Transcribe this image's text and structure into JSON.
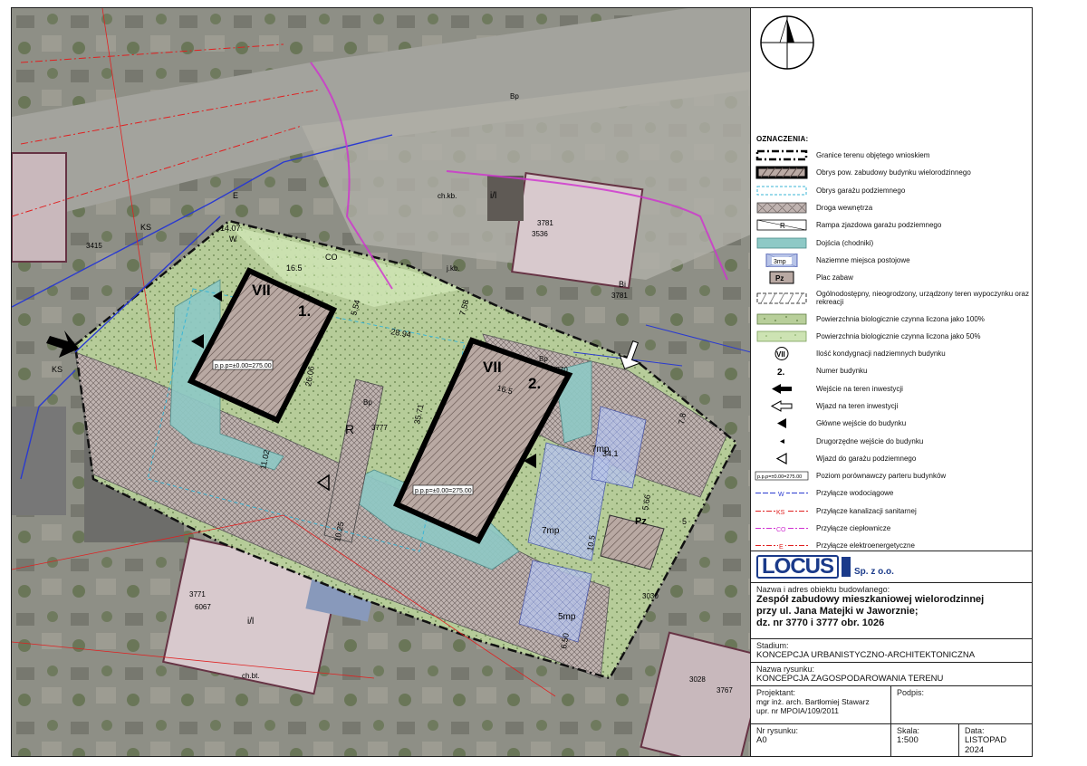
{
  "map": {
    "building_1": {
      "floors": "VII",
      "number": "1.",
      "level": "p.p.p=±0.00=275.00"
    },
    "building_2": {
      "floors": "VII",
      "number": "2.",
      "level": "p.p.p=±0.00=275.00"
    },
    "dimensions": {
      "d1": "16.5",
      "d2": "5.54",
      "d3": "7.58",
      "d4": "28.94",
      "d5": "26.06",
      "d6": "35.71",
      "d7": "16.5",
      "d8": "11.02",
      "d9": "14.07",
      "d10": "10.25",
      "d11": "34.1",
      "d12": "7.8",
      "d13": "5.66",
      "d14": "10.5",
      "d15": "6.50",
      "d16": "5"
    },
    "parking": {
      "p1": "7mp",
      "p2": "7mp",
      "p3": "5mp"
    },
    "labels": {
      "ramp": "R",
      "playground": "Pz",
      "co": "CO",
      "ks1": "KS",
      "ks2": "KS",
      "e": "E",
      "w": "W",
      "bp1": "Bp",
      "bp2": "Bp",
      "bp3": "Bp",
      "bi": "Bi",
      "n3777": "3777",
      "n3770": "3770",
      "n3781a": "3781",
      "n3781b": "3781",
      "n3536": "3536",
      "n3415": "3415",
      "n3771": "3771",
      "n6067": "6067",
      "n3767": "3767",
      "n3028": "3028",
      "n3030": "3030",
      "chkb": "ch.kb.",
      "chbt": "ch.bt.",
      "il1": "i/l",
      "il2": "i/l",
      "jkb": "j.kb."
    },
    "colors": {
      "boundary": "#111111",
      "roads": "#d8d0cc",
      "red_lines": "#e02020",
      "blue_lines": "#2a3ad0",
      "magenta_lines": "#d030d0",
      "teal": "#7ec8c8"
    }
  },
  "legend": {
    "title": "OZNACZENIA:",
    "items": [
      {
        "label": "Granice terenu objętego wnioskiem",
        "sym": "boundary"
      },
      {
        "label": "Obrys pow. zabudowy budynku wielorodzinnego",
        "sym": "building"
      },
      {
        "label": "Obrys garażu podziemnego",
        "sym": "garage"
      },
      {
        "label": "Droga wewnętrza",
        "sym": "road"
      },
      {
        "label": "Rampa zjazdowa garażu podziemnego",
        "sym": "ramp",
        "sym_text": "R"
      },
      {
        "label": "Dojścia (chodniki)",
        "sym": "walk"
      },
      {
        "label": "Naziemne miejsca postojowe",
        "sym": "parking",
        "sym_text": "3mp"
      },
      {
        "label": "Plac zabaw",
        "sym": "play",
        "sym_text": "Pz"
      },
      {
        "label": "Ogólnodostępny, nieogrodzony, urządzony teren wypoczynku oraz rekreacji",
        "sym": "recreation"
      },
      {
        "label": "Powierzchnia biologicznie czynna liczona jako 100%",
        "sym": "green100"
      },
      {
        "label": "Powierzchnia biologicznie czynna liczona jako 50%",
        "sym": "green50"
      },
      {
        "label": "Ilość kondygnacji nadziemnych budynku",
        "sym": "floors",
        "sym_text": "VII"
      },
      {
        "label": "Numer budynku",
        "sym": "number",
        "sym_text": "2."
      },
      {
        "label": "Wejście na teren inwestycji",
        "sym": "entry"
      },
      {
        "label": "Wjazd na teren inwestycji",
        "sym": "drive"
      },
      {
        "label": "Główne wejście do budynku",
        "sym": "main_entry"
      },
      {
        "label": "Drugorzędne wejście do budynku",
        "sym": "secondary_entry"
      },
      {
        "label": "Wjazd do garażu podziemnego",
        "sym": "garage_entry"
      },
      {
        "label": "Poziom porównawczy parteru budynków",
        "sym": "level"
      },
      {
        "label": "Przyłącze wodociągowe",
        "sym": "water",
        "sym_text": "W"
      },
      {
        "label": "Przyłącze kanalizacji sanitarnej",
        "sym": "sewer",
        "sym_text": "KS"
      },
      {
        "label": "Przyłącze ciepłownicze",
        "sym": "heat",
        "sym_text": "CO"
      },
      {
        "label": "Przyłącze elektroenergetyczne",
        "sym": "power",
        "sym_text": "E"
      }
    ]
  },
  "titleblock": {
    "logo": "LOCUS",
    "logo_sub": "Sp. z o.o.",
    "name_label": "Nazwa i adres obiektu budowlanego:",
    "name_lines": [
      "Zespół zabudowy mieszkaniowej wielorodzinnej",
      "przy ul. Jana Matejki w Jaworznie;",
      "dz. nr 3770 i 3777 obr. 1026"
    ],
    "stadium_label": "Stadium:",
    "stadium": "KONCEPCJA URBANISTYCZNO-ARCHITEKTONICZNA",
    "drawing_label": "Nazwa rysunku:",
    "drawing": "KONCEPCJA ZAGOSPODAROWANIA TERENU",
    "designer_label": "Projektant:",
    "designer": "mgr inż. arch. Bartłomiej Stawarz",
    "designer_lic": "upr. nr MPOIA/109/2011",
    "signature_label": "Podpis:",
    "number_label": "Nr rysunku:",
    "number": "A0",
    "scale_label": "Skala:",
    "scale": "1:500",
    "date_label": "Data:",
    "date": "LISTOPAD 2024"
  }
}
